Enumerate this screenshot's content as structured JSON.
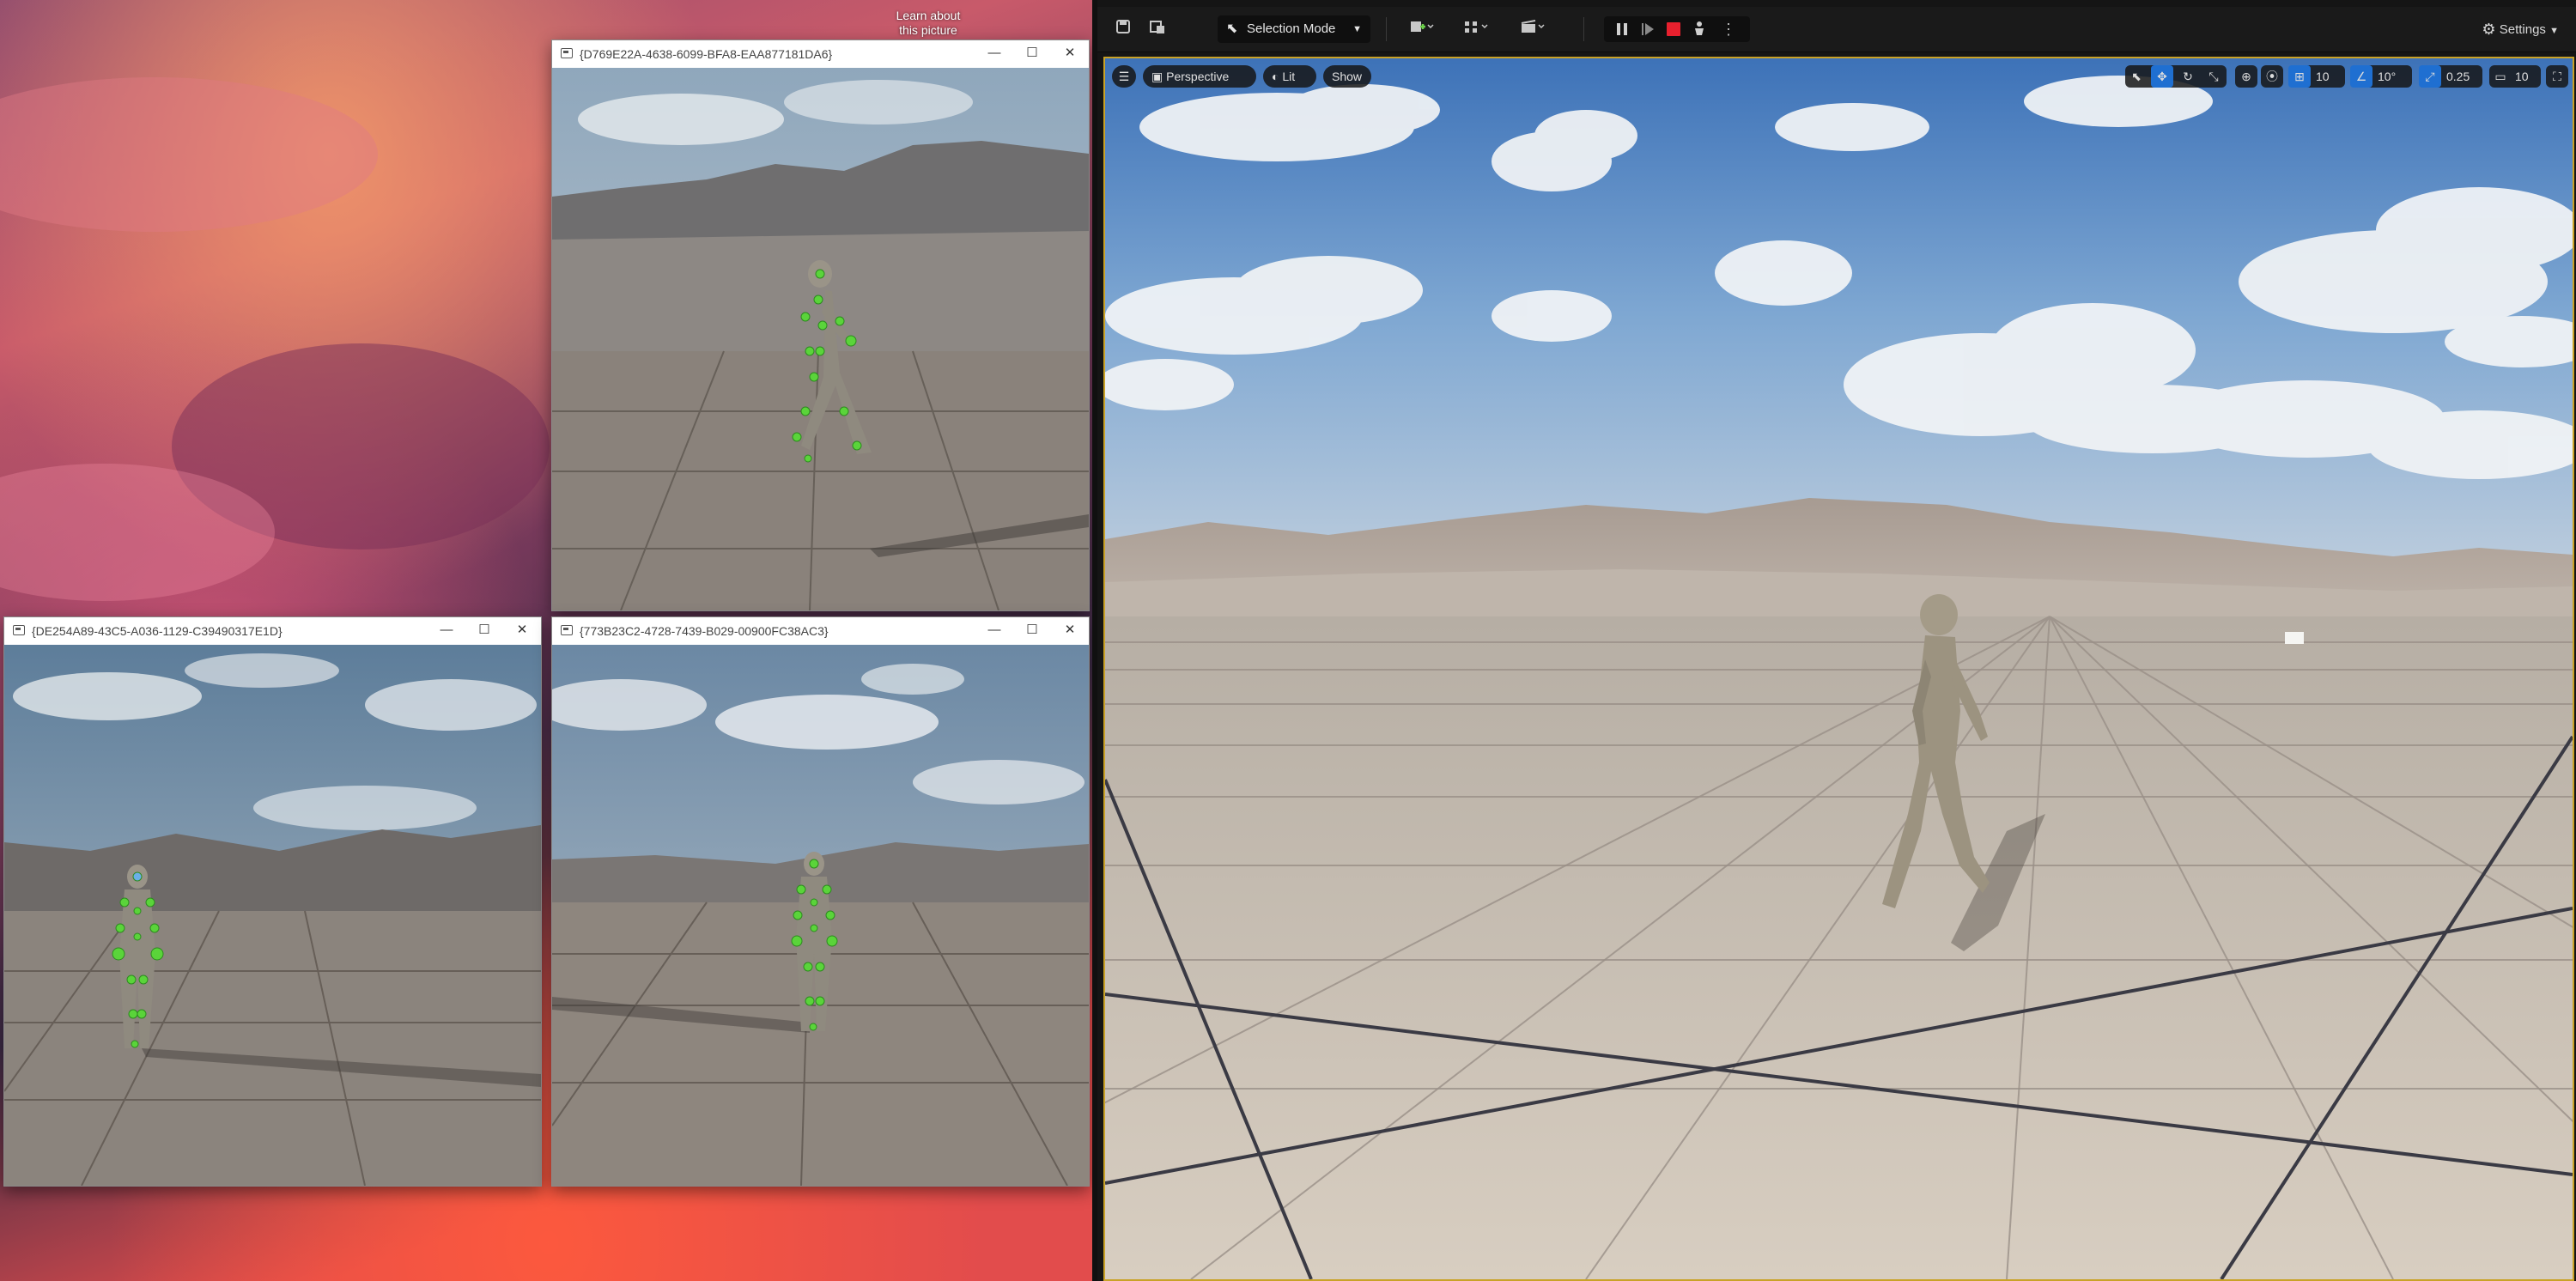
{
  "desktop": {
    "learn_text": "Learn about this picture"
  },
  "windows": [
    {
      "title": "{D769E22A-4638-6099-BFA8-EAA877181DA6}"
    },
    {
      "title": "{DE254A89-43C5-A036-1129-C39490317E1D}"
    },
    {
      "title": "{773B23C2-4728-7439-B029-00900FC38AC3}"
    }
  ],
  "window_controls": {
    "minimize": "—",
    "maximize": "☐",
    "close": "✕"
  },
  "editor": {
    "selection_mode": "Selection Mode",
    "settings": "Settings",
    "viewport": {
      "perspective": "Perspective",
      "lit": "Lit",
      "show": "Show",
      "grid_snap": "10",
      "rotation_snap": "10°",
      "scale_snap": "0.25",
      "camera_speed": "10"
    }
  },
  "colors": {
    "viewport_border": "#c9a227",
    "active_tool": "#1f6fd1",
    "stop_button": "#e8202e",
    "skeleton_joint": "#5ad43a"
  },
  "icons": [
    "save-icon",
    "content-browser-icon",
    "cursor-icon",
    "add-actor-icon",
    "blueprint-icon",
    "cinematics-icon",
    "pause-icon",
    "resume-icon",
    "stop-icon",
    "eject-icon",
    "more-icon",
    "settings-icon",
    "menu-icon",
    "cube-icon",
    "select-icon",
    "translate-icon",
    "rotate-icon",
    "scale-icon",
    "world-icon",
    "surface-snap-icon",
    "grid-icon",
    "angle-icon",
    "scale-snap-icon",
    "camera-icon",
    "maximize-icon"
  ]
}
